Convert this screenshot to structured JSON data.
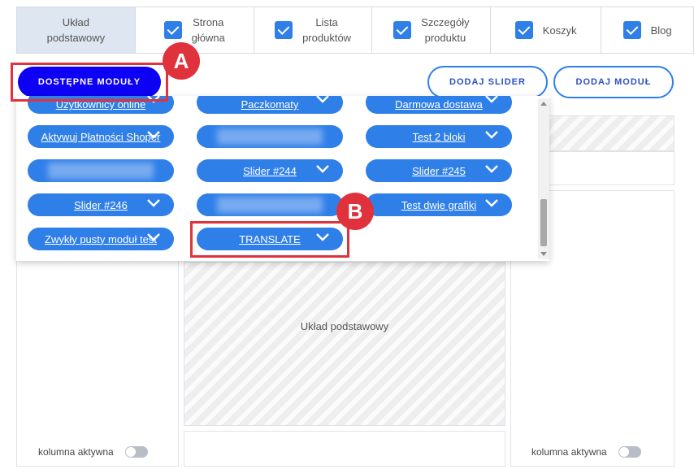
{
  "tabs": [
    {
      "label": "Układ\npodstawowy",
      "checked": false,
      "active": true
    },
    {
      "label": "Strona\ngłówna",
      "checked": true,
      "active": false
    },
    {
      "label": "Lista\nproduktów",
      "checked": true,
      "active": false
    },
    {
      "label": "Szczegóły\nproduktu",
      "checked": true,
      "active": false
    },
    {
      "label": "Koszyk",
      "checked": true,
      "active": false
    },
    {
      "label": "Blog",
      "checked": true,
      "active": false
    }
  ],
  "toolbar": {
    "available_modules_label": "DOSTĘPNE MODUŁY",
    "add_slider_label": "DODAJ SLIDER",
    "add_module_label": "DODAJ MODUŁ"
  },
  "modules": [
    {
      "label": "Użytkownicy online",
      "chevron": true,
      "blurred": false
    },
    {
      "label": "Paczkomaty",
      "chevron": true,
      "blurred": false
    },
    {
      "label": "Darmowa dostawa",
      "chevron": true,
      "blurred": false
    },
    {
      "label": "Aktywuj Płatności Shoper",
      "chevron": true,
      "blurred": false
    },
    {
      "label": "",
      "chevron": false,
      "blurred": true
    },
    {
      "label": "Test 2 bloki",
      "chevron": true,
      "blurred": false
    },
    {
      "label": "",
      "chevron": false,
      "blurred": true
    },
    {
      "label": "Slider #244",
      "chevron": true,
      "blurred": false
    },
    {
      "label": "Slider #245",
      "chevron": true,
      "blurred": false
    },
    {
      "label": "Slider #246",
      "chevron": true,
      "blurred": false
    },
    {
      "label": "",
      "chevron": false,
      "blurred": true
    },
    {
      "label": "Test dwie grafiki",
      "chevron": true,
      "blurred": false
    },
    {
      "label": "Zwykły pusty moduł test",
      "chevron": true,
      "blurred": false
    },
    {
      "label": "TRANSLATE",
      "chevron": true,
      "blurred": false
    }
  ],
  "layout": {
    "center_label": "Układ podstawowy",
    "left_column_toggle_label": "kolumna aktywna",
    "right_column_toggle_label": "kolumna aktywna"
  },
  "annotations": {
    "marker_a": "A",
    "marker_b": "B"
  },
  "colors": {
    "accent": "#2f7fe9",
    "primary_button": "#0d00f5",
    "highlight": "#e0323c"
  }
}
